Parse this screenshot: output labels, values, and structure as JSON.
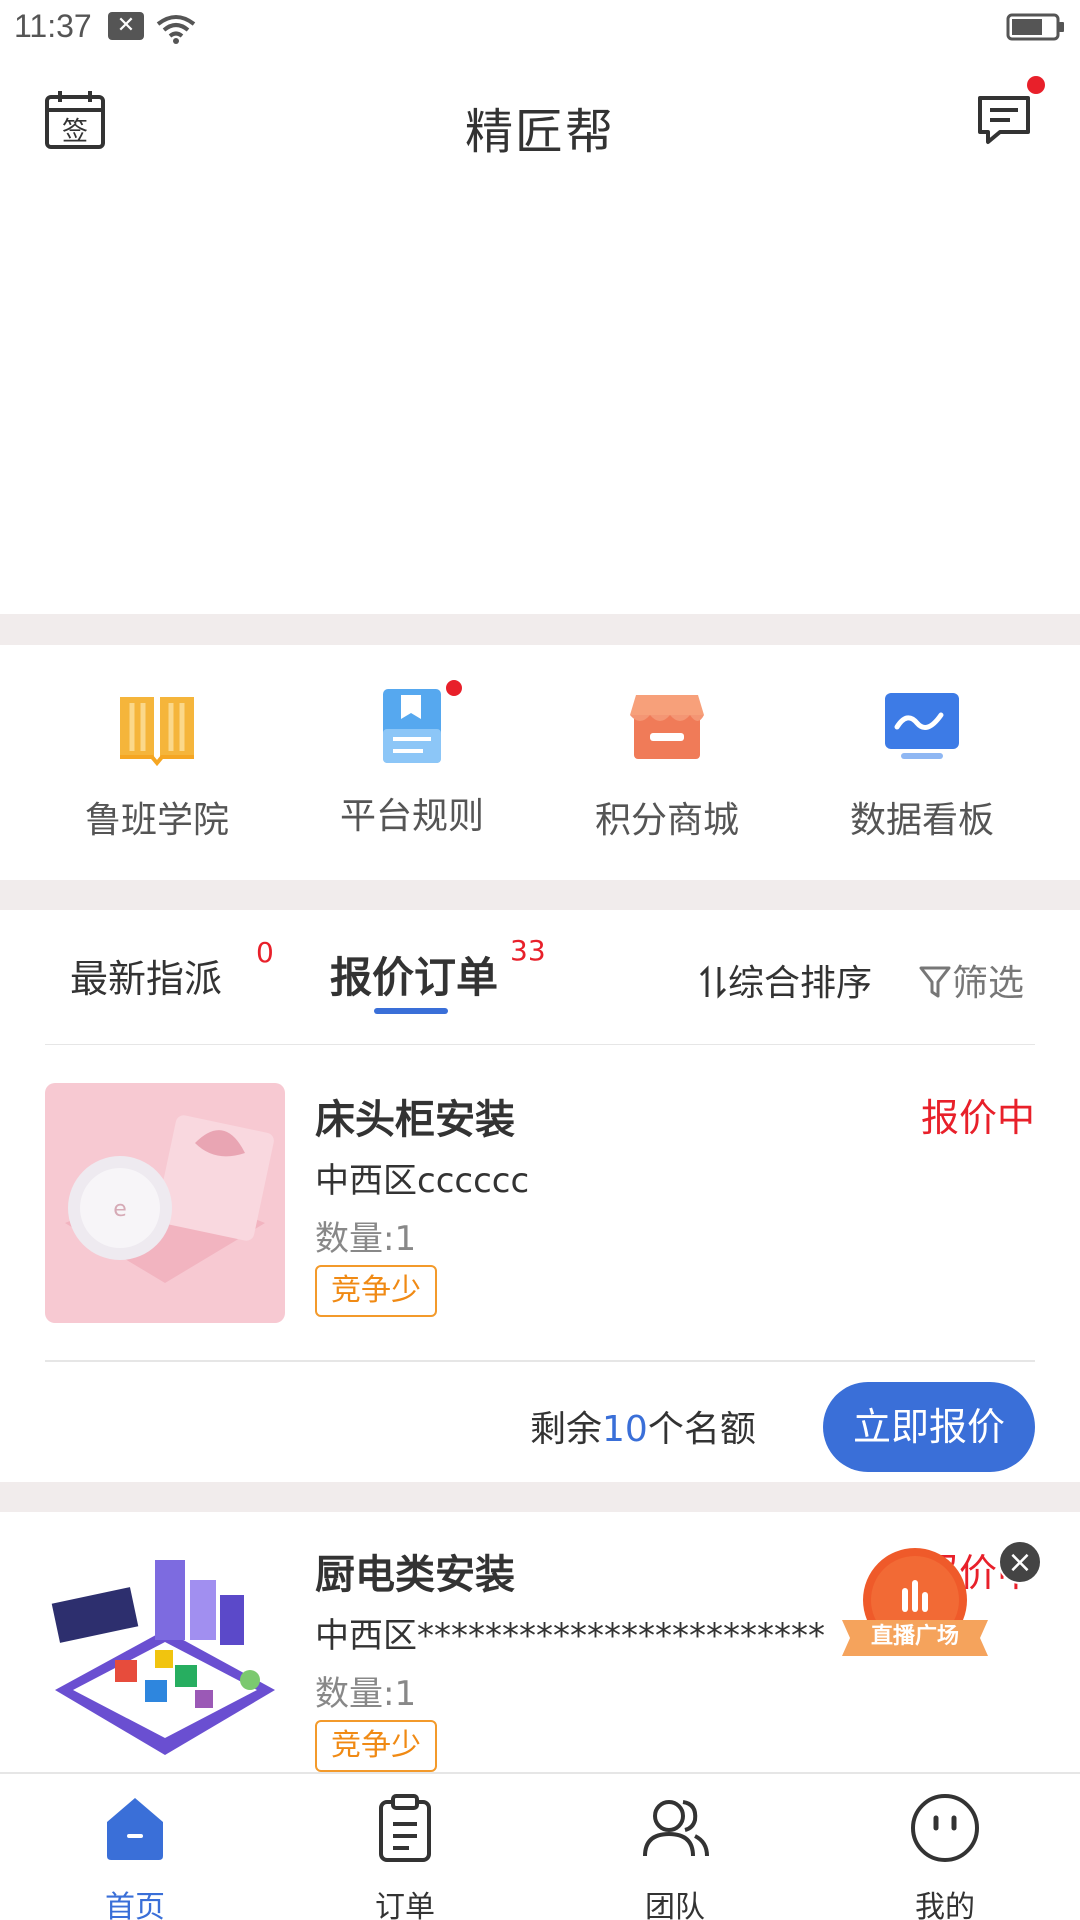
{
  "status_bar": {
    "time": "11:37"
  },
  "header": {
    "title": "精匠帮"
  },
  "quick_entries": [
    {
      "label": "鲁班学院",
      "icon": "book-icon"
    },
    {
      "label": "平台规则",
      "icon": "rules-icon",
      "has_dot": true
    },
    {
      "label": "积分商城",
      "icon": "store-icon"
    },
    {
      "label": "数据看板",
      "icon": "dashboard-icon"
    }
  ],
  "tabs": {
    "latest": {
      "label": "最新指派",
      "badge": "0"
    },
    "quote": {
      "label": "报价订单",
      "badge": "33"
    },
    "sort_label": "综合排序",
    "filter_label": "筛选"
  },
  "orders": [
    {
      "title": "床头柜安装",
      "status": "报价中",
      "address": "中西区cccccc",
      "quantity": "数量:1",
      "tag": "竞争少",
      "remaining_prefix": "剩余",
      "remaining_count": "10",
      "remaining_suffix": "个名额",
      "button": "立即报价"
    },
    {
      "title": "厨电类安装",
      "status": "报价中",
      "address": "中西区************************",
      "quantity": "数量:1",
      "tag": "竞争少"
    }
  ],
  "live_float": {
    "label": "直播广场"
  },
  "bottom_nav": [
    {
      "label": "首页",
      "active": true
    },
    {
      "label": "订单"
    },
    {
      "label": "团队"
    },
    {
      "label": "我的"
    }
  ],
  "colors": {
    "accent": "#3a6fd8",
    "danger": "#e8202a",
    "tag_orange": "#f08a14",
    "gap_bg": "#f1ecec"
  }
}
